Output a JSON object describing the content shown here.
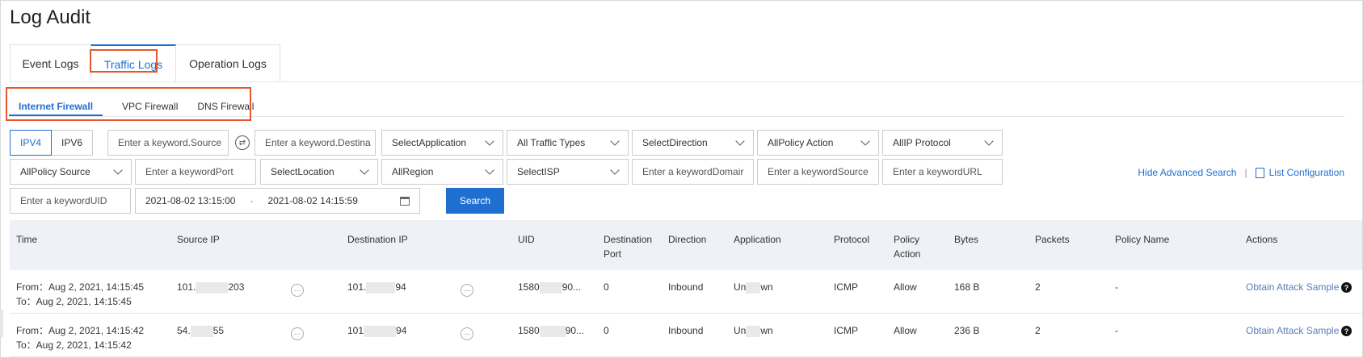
{
  "page": {
    "title": "Log Audit"
  },
  "tabs": [
    {
      "label": "Event Logs"
    },
    {
      "label": "Traffic Logs"
    },
    {
      "label": "Operation Logs"
    }
  ],
  "subtabs": [
    {
      "label": "Internet Firewall"
    },
    {
      "label": "VPC Firewall"
    },
    {
      "label": "DNS Firewall"
    }
  ],
  "filters": {
    "ipv4": "IPV4",
    "ipv6": "IPV6",
    "source_keyword": "Enter a keyword.Source",
    "destination_keyword": "Enter a keyword.Destina",
    "application": "SelectApplication",
    "traffic_types": "All Traffic Types",
    "direction": "SelectDirection",
    "policy_action": "AllPolicy Action",
    "ip_protocol": "AllIP Protocol",
    "policy_source": "AllPolicy Source",
    "port_keyword": "Enter a keywordPort",
    "location": "SelectLocation",
    "region": "AllRegion",
    "isp": "SelectISP",
    "domain_keyword": "Enter a keywordDomair",
    "source_keyword2": "Enter a keywordSource",
    "url_keyword": "Enter a keywordURL",
    "uid_keyword": "Enter a keywordUID",
    "date_start": "2021-08-02 13:15:00",
    "date_sep": "-",
    "date_end": "2021-08-02 14:15:59",
    "search_label": "Search"
  },
  "toolbar": {
    "hide_advanced": "Hide Advanced Search",
    "separator": "|",
    "list_config": "List Configuration"
  },
  "table": {
    "headers": {
      "time": "Time",
      "source_ip": "Source IP",
      "destination_ip": "Destination IP",
      "uid": "UID",
      "dest_port_1": "Destination",
      "dest_port_2": "Port",
      "direction": "Direction",
      "application": "Application",
      "protocol": "Protocol",
      "policy_action_1": "Policy",
      "policy_action_2": "Action",
      "bytes": "Bytes",
      "packets": "Packets",
      "policy_name": "Policy Name",
      "actions": "Actions"
    },
    "rows": [
      {
        "from": "From：Aug 2, 2021, 14:15:45",
        "to": "To：Aug 2, 2021, 14:15:45",
        "src_a": "101.",
        "src_b": "203",
        "dst_a": "101.",
        "dst_b": "94",
        "uid_a": "1580",
        "uid_b": "90...",
        "port": "0",
        "direction": "Inbound",
        "app_a": "Un",
        "app_b": "wn",
        "protocol": "ICMP",
        "policy_action": "Allow",
        "bytes": "168 B",
        "packets": "2",
        "policy_name": "-",
        "action": "Obtain Attack Sample"
      },
      {
        "from": "From：Aug 2, 2021, 14:15:42",
        "to": "To：Aug 2, 2021, 14:15:42",
        "src_a": "54.",
        "src_b": "55",
        "dst_a": "101",
        "dst_b": "94",
        "uid_a": "1580",
        "uid_b": "90...",
        "port": "0",
        "direction": "Inbound",
        "app_a": "Un",
        "app_b": "wn",
        "protocol": "ICMP",
        "policy_action": "Allow",
        "bytes": "236 B",
        "packets": "2",
        "policy_name": "-",
        "action": "Obtain Attack Sample"
      }
    ]
  },
  "icons": {
    "more": "ellipsis-icon",
    "help": "question-icon",
    "swap": "swap-icon",
    "calendar": "calendar-icon"
  },
  "colors": {
    "accent": "#1f6fd1",
    "highlight": "#e4572e"
  }
}
